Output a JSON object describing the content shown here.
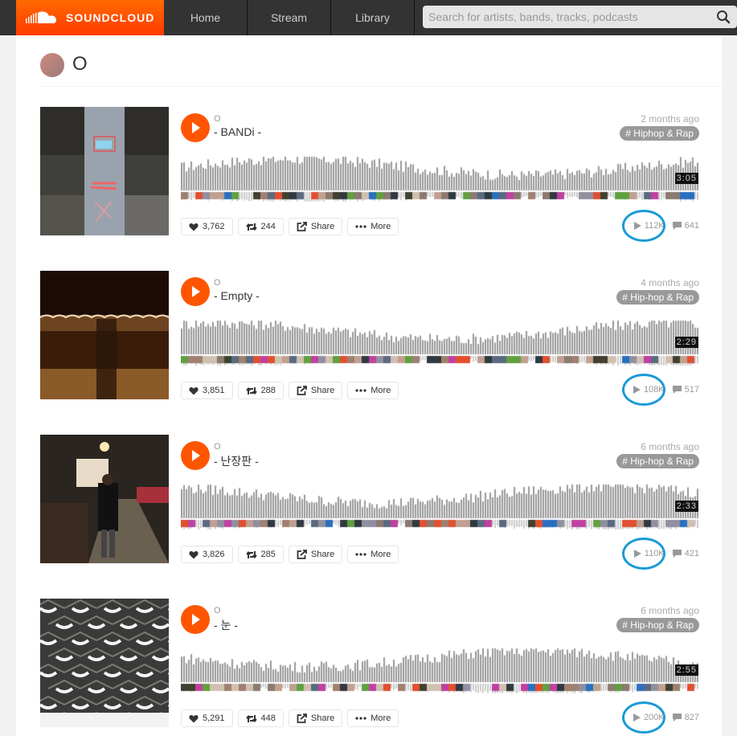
{
  "nav": {
    "brand": "SOUNDCLOUD",
    "items": [
      {
        "label": "Home"
      },
      {
        "label": "Stream"
      },
      {
        "label": "Library"
      }
    ],
    "search_placeholder": "Search for artists, bands, tracks, podcasts"
  },
  "profile": {
    "name": "O"
  },
  "colors": {
    "brand": "#ff5500",
    "highlight_circle": "#1a9ad6"
  },
  "tracks": [
    {
      "user": "O",
      "title": "- BANDi -",
      "date": "2 months ago",
      "tag": "# Hiphop & Rap",
      "duration": "3:05",
      "likes": "3,762",
      "reposts": "244",
      "share": "Share",
      "more": "More",
      "plays": "112K",
      "comments": "641"
    },
    {
      "user": "O",
      "title": "- Empty -",
      "date": "4 months ago",
      "tag": "# Hip-hop & Rap",
      "duration": "2:29",
      "likes": "3,851",
      "reposts": "288",
      "share": "Share",
      "more": "More",
      "plays": "108K",
      "comments": "517"
    },
    {
      "user": "O",
      "title": "- 난장판 -",
      "date": "6 months ago",
      "tag": "# Hip-hop & Rap",
      "duration": "2:33",
      "likes": "3,826",
      "reposts": "285",
      "share": "Share",
      "more": "More",
      "plays": "110K",
      "comments": "421"
    },
    {
      "user": "O",
      "title": "- 눈 -",
      "date": "6 months ago",
      "tag": "# Hip-hop & Rap",
      "duration": "2:55",
      "likes": "5,291",
      "reposts": "448",
      "share": "Share",
      "more": "More",
      "plays": "200K",
      "comments": "827"
    }
  ]
}
